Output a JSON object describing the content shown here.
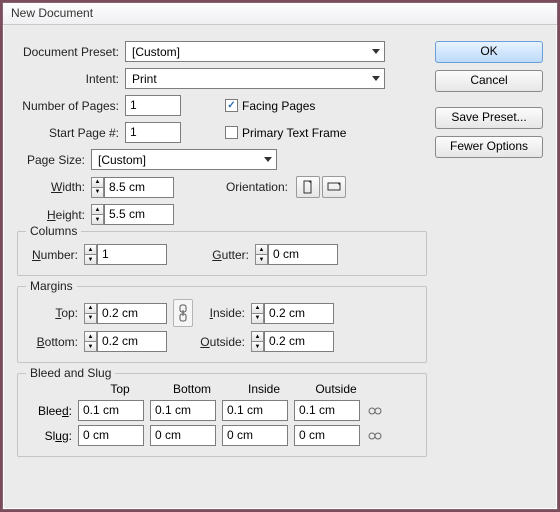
{
  "title": "New Document",
  "buttons": {
    "ok": "OK",
    "cancel": "Cancel",
    "savePreset": "Save Preset...",
    "fewerOptions": "Fewer Options"
  },
  "labels": {
    "docPreset": "Document Preset:",
    "intent": "Intent:",
    "numPages": "Number of Pages:",
    "startPage": "Start Page #:",
    "facingPages": "Facing Pages",
    "primaryTextFrame": "Primary Text Frame",
    "pageSize": "Page Size:",
    "width": "Width:",
    "height": "Height:",
    "orientation": "Orientation:",
    "columns": "Columns",
    "number": "Number:",
    "gutter": "Gutter:",
    "margins": "Margins",
    "top": "Top:",
    "bottom": "Bottom:",
    "inside": "Inside:",
    "outside": "Outside:",
    "bleedSlug": "Bleed and Slug",
    "bleed": "Bleed:",
    "slug": "Slug:",
    "hTop": "Top",
    "hBottom": "Bottom",
    "hInside": "Inside",
    "hOutside": "Outside"
  },
  "values": {
    "docPreset": "[Custom]",
    "intent": "Print",
    "numPages": "1",
    "startPage": "1",
    "facingPages": true,
    "primaryTextFrame": false,
    "pageSize": "[Custom]",
    "width": "8.5 cm",
    "height": "5.5 cm",
    "columnsNumber": "1",
    "gutter": "0 cm",
    "marginTop": "0.2 cm",
    "marginBottom": "0.2 cm",
    "marginInside": "0.2 cm",
    "marginOutside": "0.2 cm",
    "bleed": {
      "top": "0.1 cm",
      "bottom": "0.1 cm",
      "inside": "0.1 cm",
      "outside": "0.1 cm"
    },
    "slug": {
      "top": "0 cm",
      "bottom": "0 cm",
      "inside": "0 cm",
      "outside": "0 cm"
    }
  }
}
